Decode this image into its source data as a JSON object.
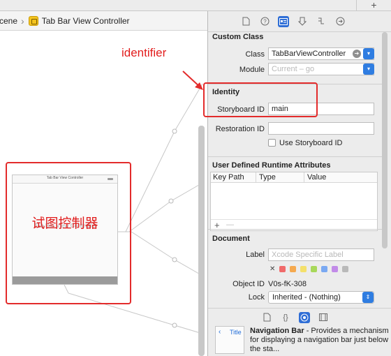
{
  "jumpbar": {
    "scene": "cene",
    "vc": "Tab Bar View Controller"
  },
  "topstrip": {
    "plus": "+"
  },
  "scene": {
    "nav_title": "Tab Bar View Controller",
    "body_label": "Tab Bar View Controller",
    "red_label": "试图控制器"
  },
  "annotations": {
    "identifier": "identifier"
  },
  "inspector": {
    "custom_class": {
      "title": "Custom Class",
      "class_label": "Class",
      "class_value": "TabBarViewController",
      "module_label": "Module",
      "module_placeholder": "Current – go"
    },
    "identity": {
      "title": "Identity",
      "storyboard_id_label": "Storyboard ID",
      "storyboard_id_value": "main",
      "restoration_id_label": "Restoration ID",
      "restoration_id_value": "",
      "use_storyboard_id_label": "Use Storyboard ID"
    },
    "udra": {
      "title": "User Defined Runtime Attributes",
      "columns": [
        "Key Path",
        "Type",
        "Value"
      ],
      "add": "+",
      "remove": "—"
    },
    "document": {
      "title": "Document",
      "label_label": "Label",
      "label_placeholder": "Xcode Specific Label",
      "object_id_label": "Object ID",
      "object_id_value": "V0s-fK-308",
      "lock_label": "Lock",
      "lock_value": "Inherited - (Nothing)",
      "color_x": "✕",
      "colors": [
        "#f06a6a",
        "#f5a94f",
        "#f4e06b",
        "#a8d85a",
        "#7aa9f2",
        "#c28be8",
        "#b9b9b9"
      ]
    },
    "library": {
      "thumb_chevron": "‹",
      "thumb_title": "Title",
      "item_name": "Navigation Bar",
      "item_desc": " - Provides a mechanism for displaying a navigation bar just below the sta..."
    }
  }
}
